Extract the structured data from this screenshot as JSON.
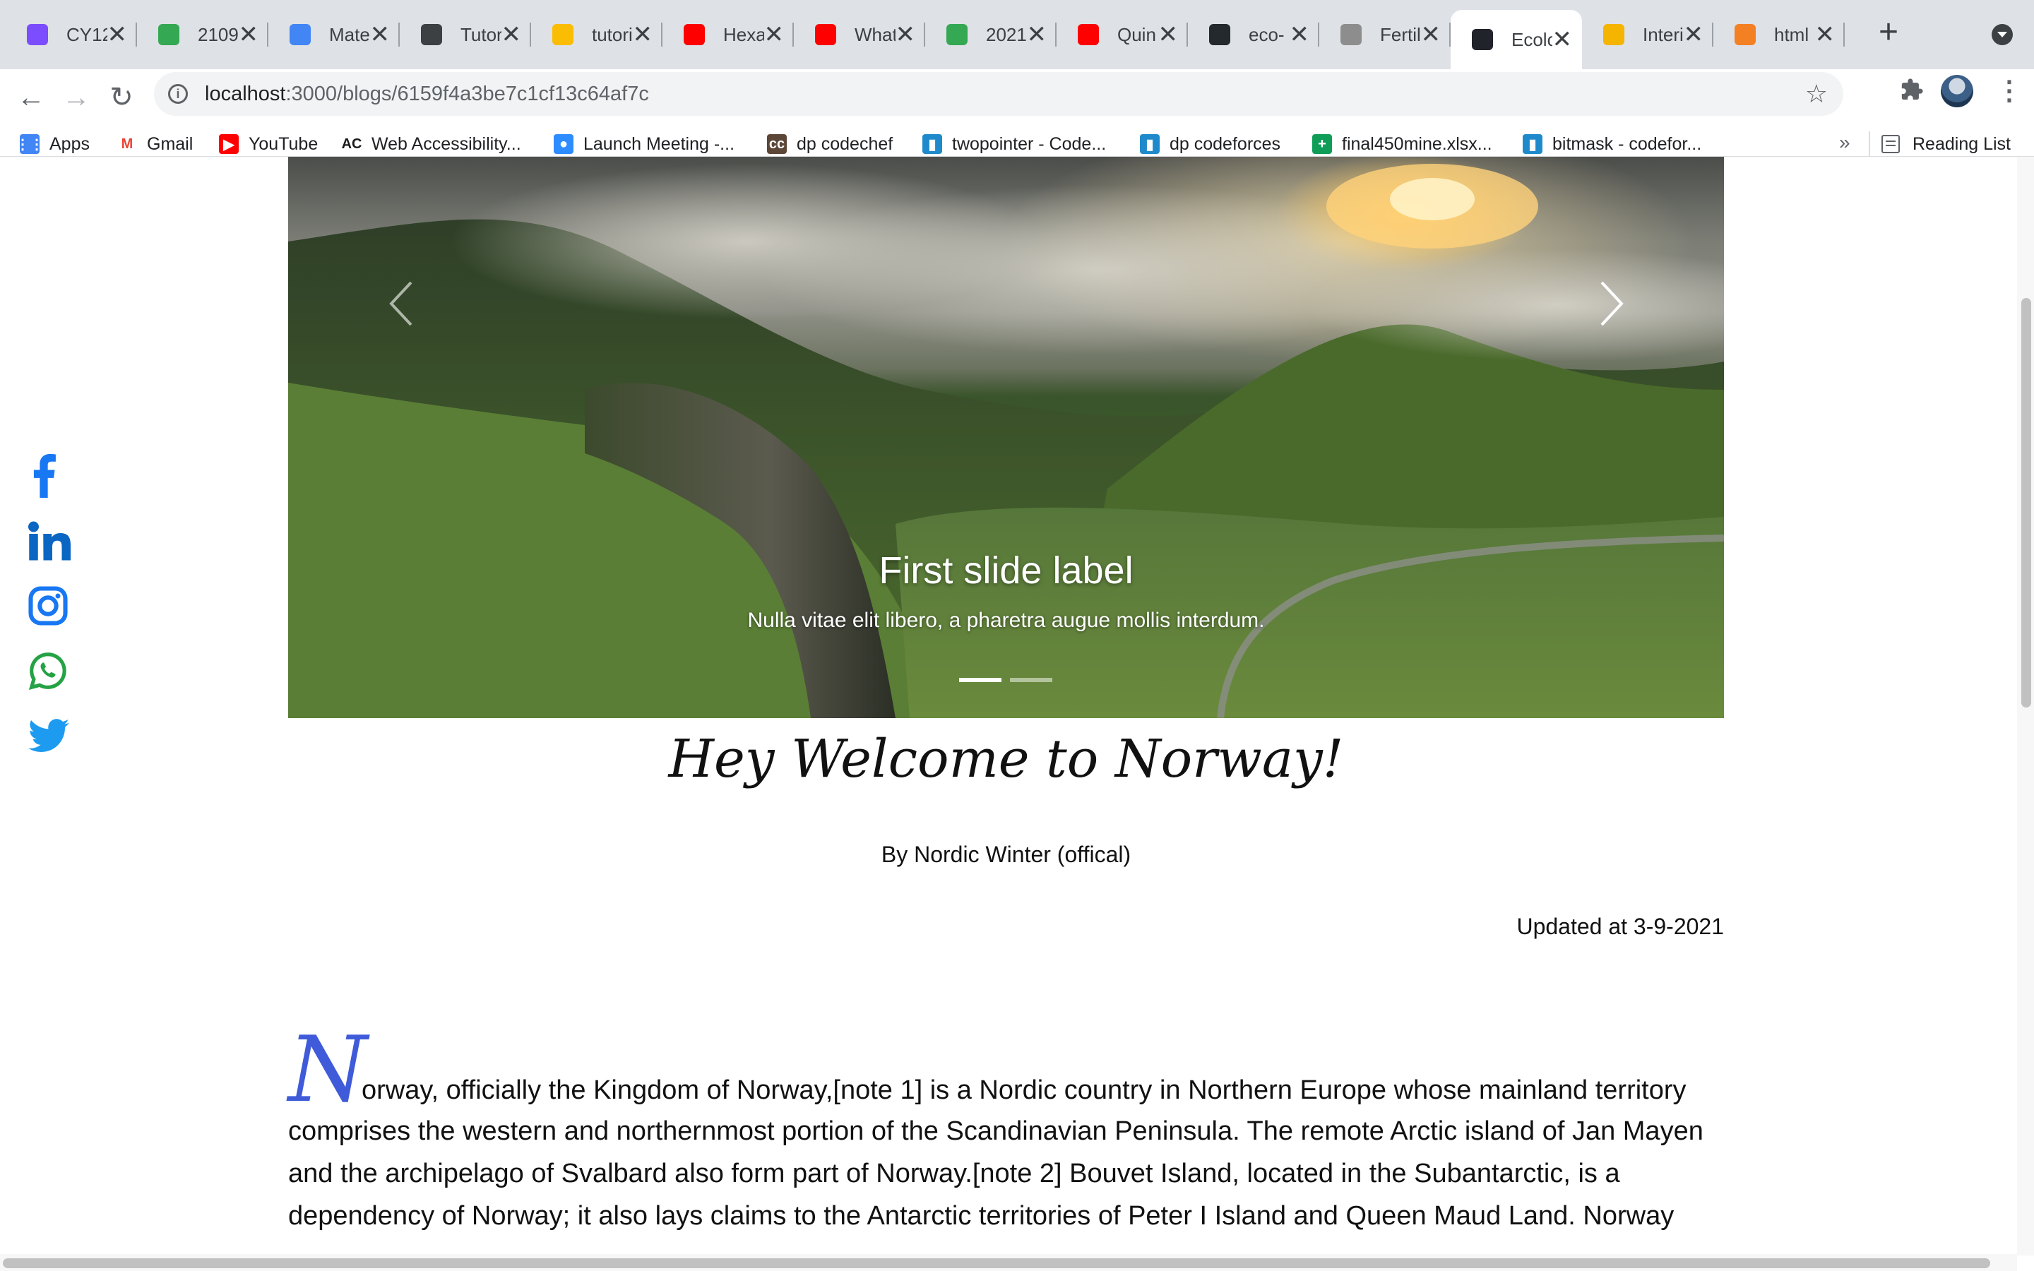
{
  "browser": {
    "tabs": [
      {
        "title": "CY12",
        "icon": "purple-app-icon",
        "color": "#7c4dff"
      },
      {
        "title": "2109",
        "icon": "google-drive-icon",
        "color": "#34a853"
      },
      {
        "title": "Mate",
        "icon": "google-classroom-icon",
        "color": "#4285f4"
      },
      {
        "title": "Tutor",
        "icon": "contact-card-icon",
        "color": "#3c4043"
      },
      {
        "title": "tutori",
        "icon": "google-drive-icon",
        "color": "#fbbc04"
      },
      {
        "title": "Hexa",
        "icon": "youtube-icon",
        "color": "#ff0000"
      },
      {
        "title": "What",
        "icon": "youtube-icon",
        "color": "#ff0000"
      },
      {
        "title": "2021",
        "icon": "google-drive-icon",
        "color": "#34a853"
      },
      {
        "title": "Quin",
        "icon": "youtube-icon",
        "color": "#ff0000"
      },
      {
        "title": "eco-",
        "icon": "github-icon",
        "color": "#24292e"
      },
      {
        "title": "Fertil",
        "icon": "globe-icon",
        "color": "#8d8d8d"
      },
      {
        "title": "Ecolo",
        "icon": "react-icon",
        "color": "#20232a",
        "active": true
      },
      {
        "title": "Interi",
        "icon": "sun-icon",
        "color": "#f4b400"
      },
      {
        "title": "html",
        "icon": "stackoverflow-icon",
        "color": "#f48024"
      }
    ],
    "new_tab_symbol": "+",
    "close_symbol": "✕",
    "url_host": "localhost",
    "url_path": ":3000/blogs/6159f4a3be7c1cf13c64af7c",
    "bookmarks": [
      {
        "label": "Apps",
        "icon": "apps-grid-icon"
      },
      {
        "label": "Gmail",
        "icon": "gmail-icon"
      },
      {
        "label": "YouTube",
        "icon": "youtube-icon"
      },
      {
        "label": "Web Accessibility...",
        "icon": "ac-icon"
      },
      {
        "label": "Launch Meeting -...",
        "icon": "zoom-icon"
      },
      {
        "label": "dp codechef",
        "icon": "codechef-icon"
      },
      {
        "label": "twopointer - Code...",
        "icon": "codeforces-icon"
      },
      {
        "label": "dp codeforces",
        "icon": "codeforces-icon"
      },
      {
        "label": "final450mine.xlsx...",
        "icon": "sheets-icon"
      },
      {
        "label": "bitmask - codefor...",
        "icon": "codeforces-icon"
      }
    ],
    "more_bookmarks": "»",
    "reading_list": "Reading List"
  },
  "page": {
    "social": [
      "facebook-icon",
      "linkedin-icon",
      "instagram-icon",
      "whatsapp-icon",
      "twitter-icon"
    ],
    "carousel": {
      "slide_title": "First slide label",
      "slide_text": "Nulla vitae elit libero, a pharetra augue mollis interdum.",
      "active_slide": 1,
      "slide_count": 2
    },
    "title": "Hey Welcome to Norway!",
    "byline": "By Nordic Winter (offical)",
    "updated": "Updated at 3-9-2021",
    "dropcap": "N",
    "first_line": "orway, officially the Kingdom of Norway,[note 1] is a Nordic country in Northern Europe whose mainland territory",
    "body": "comprises the western and northernmost portion of the Scandinavian Peninsula. The remote Arctic island of Jan Mayen and the archipelago of Svalbard also form part of Norway.[note 2] Bouvet Island, located in the Subantarctic, is a dependency of Norway; it also lays claims to the Antarctic territories of Peter I Island and Queen Maud Land. Norway"
  },
  "colors": {
    "accent_blue": "#1877f2",
    "dropcap": "#3f5bd9",
    "whatsapp": "#25a244"
  }
}
